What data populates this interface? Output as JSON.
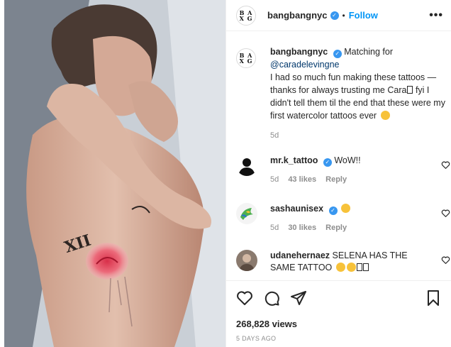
{
  "brand_logo": {
    "line1": "B A",
    "line2": "X G"
  },
  "header": {
    "username": "bangbangnyc",
    "separator": "•",
    "follow_label": "Follow",
    "more_label": "•••",
    "more_icon": "more-options-icon"
  },
  "caption": {
    "username": "bangbangnyc",
    "text_lead": "Matching for",
    "mention": "@caradelevingne",
    "text_body": "I had so much fun making these tattoos — thanks for always trusting me Cara",
    "text_body2": "fyi I didn't tell them til the end that these were my first watercolor tattoos ever",
    "timestamp": "5d"
  },
  "comments": [
    {
      "username": "mr.k_tattoo",
      "verified": true,
      "text": "WoW!!",
      "age": "5d",
      "likes": "43 likes",
      "reply": "Reply"
    },
    {
      "username": "sashaunisex",
      "verified": true,
      "text": "",
      "age": "5d",
      "likes": "30 likes",
      "reply": "Reply"
    },
    {
      "username": "udanehernaez",
      "verified": false,
      "text": "SELENA HAS THE SAME TATTOO"
    }
  ],
  "actions": {
    "icons": [
      "heart-icon",
      "comment-icon",
      "share-icon",
      "bookmark-icon"
    ],
    "views": "268,828 views",
    "posted": "5 DAYS AGO"
  },
  "colors": {
    "link_blue": "#0095f6",
    "verified_blue": "#3897f0",
    "mention_blue": "#00376b",
    "muted_gray": "#8e8e8e",
    "text": "#262626"
  },
  "media": {
    "tattoo_text": "XII"
  }
}
